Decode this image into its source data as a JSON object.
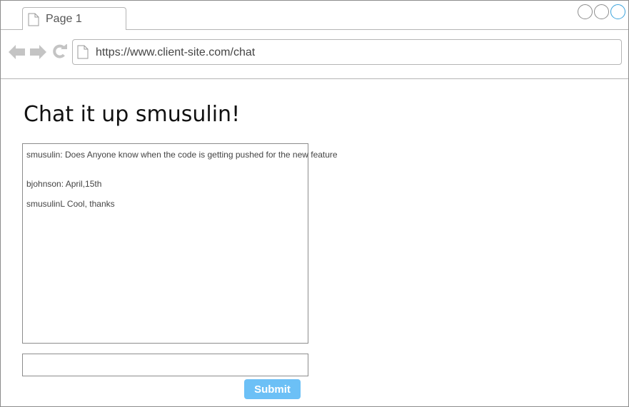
{
  "browser": {
    "tab": {
      "label": "Page 1",
      "icon": "page-icon"
    },
    "url": "https://www.client-site.com/chat",
    "window_controls": [
      "circle-icon",
      "circle-icon",
      "circle-icon"
    ],
    "accent": "#3aa3dc"
  },
  "page": {
    "title": "Chat it up smusulin!",
    "messages": [
      {
        "text": "smusulin: Does Anyone know when the code is getting pushed for the new feature"
      },
      {
        "text": "bjohnson: April,15th"
      },
      {
        "text": "smusulinL Cool, thanks"
      }
    ],
    "input": {
      "value": "",
      "placeholder": ""
    },
    "submit_label": "Submit",
    "submit_color": "#6cc0f6"
  }
}
